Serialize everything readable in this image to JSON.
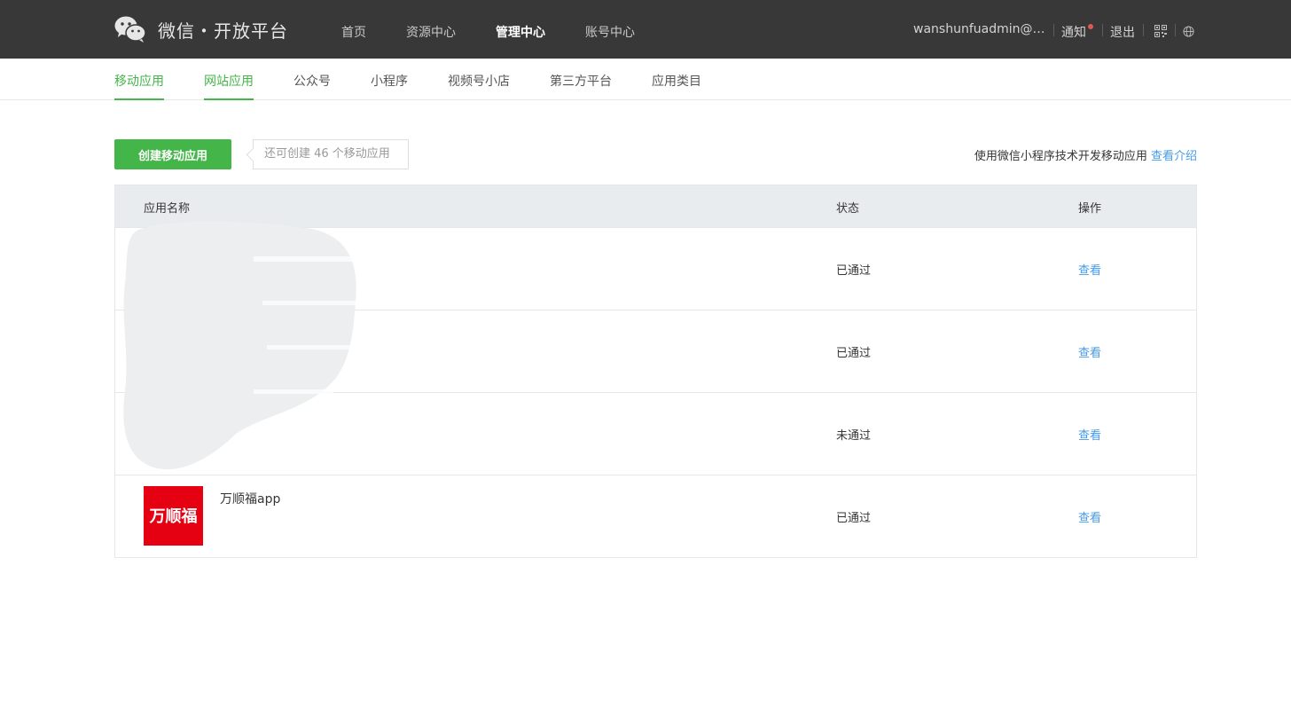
{
  "header": {
    "brand": "微信・开放平台",
    "nav": [
      "首页",
      "资源中心",
      "管理中心",
      "账号中心"
    ],
    "active_nav": "管理中心",
    "user": "wanshunfuadmin@w...",
    "notify": "通知",
    "logout": "退出",
    "colors": {
      "bar": "#383838",
      "notify_dot": "#e0584f"
    }
  },
  "subnav": {
    "items": [
      "移动应用",
      "网站应用",
      "公众号",
      "小程序",
      "视频号小店",
      "第三方平台",
      "应用类目"
    ],
    "active": [
      "移动应用",
      "网站应用"
    ],
    "accent": "#44b549"
  },
  "toolbar": {
    "create_label": "创建移动应用",
    "quota": "还可创建 46 个移动应用",
    "hint": "使用微信小程序技术开发移动应用",
    "hint_link": "查看介绍"
  },
  "table": {
    "headers": {
      "name": "应用名称",
      "status": "状态",
      "action": "操作"
    },
    "rows": [
      {
        "name": "",
        "status": "已通过",
        "action": "查看"
      },
      {
        "name": "",
        "status": "已通过",
        "action": "查看"
      },
      {
        "name": "",
        "status": "未通过",
        "action": "查看"
      },
      {
        "name": "万顺福app",
        "icon_text": "万顺福",
        "status": "已通过",
        "action": "查看"
      }
    ],
    "link_color": "#459ae9"
  }
}
